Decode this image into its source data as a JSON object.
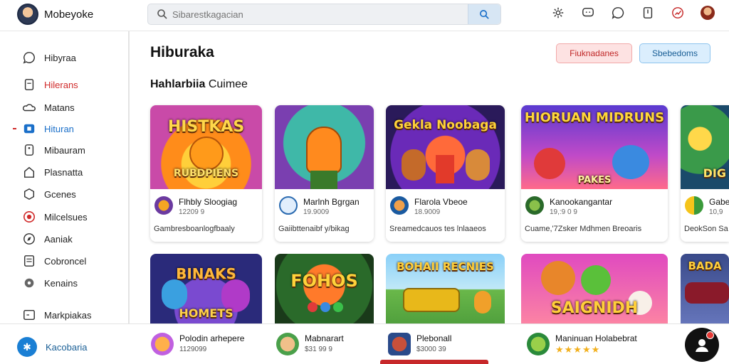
{
  "header": {
    "brand": "Mobeyoke",
    "search_placeholder": "Sibarestkagacian",
    "icons": [
      "gear-icon",
      "chat-icon",
      "message-icon",
      "share-icon",
      "notification-icon",
      "user-avatar"
    ]
  },
  "sidebar": {
    "items": [
      {
        "label": "Hibyraa",
        "icon": "speech-icon",
        "state": "normal"
      },
      {
        "label": "Hilerans",
        "icon": "bookmark-icon",
        "state": "red"
      },
      {
        "label": "Matans",
        "icon": "cloud-icon",
        "state": "normal"
      },
      {
        "label": "Hituran",
        "icon": "play-box-icon",
        "state": "active"
      },
      {
        "label": "Mibauram",
        "icon": "tag-icon",
        "state": "normal"
      },
      {
        "label": "Plasnatta",
        "icon": "house-icon",
        "state": "normal"
      },
      {
        "label": "Gcenes",
        "icon": "cube-icon",
        "state": "normal"
      },
      {
        "label": "Milcelsues",
        "icon": "target-icon",
        "state": "red-icon"
      },
      {
        "label": "Aaniak",
        "icon": "compass-icon",
        "state": "normal"
      },
      {
        "label": "Cobroncel",
        "icon": "document-icon",
        "state": "normal"
      },
      {
        "label": "Kenains",
        "icon": "circle-icon",
        "state": "normal"
      },
      {
        "label": "Markpiakas",
        "icon": "monitor-icon",
        "state": "normal"
      }
    ]
  },
  "main": {
    "title": "Hiburaka",
    "btn_red": "Fiuknadanes",
    "btn_blue": "Sbebedoms",
    "section_bold": "Hahlarbiia",
    "section_rest": "Cuimee"
  },
  "cards": [
    {
      "art_text": "HISTKAS",
      "art_sub": "RUBDPIENS",
      "title": "Flhbly Sloogiag",
      "meta": "12209 9",
      "desc": "Gambresboanlogfbaaly"
    },
    {
      "art_text": "",
      "art_sub": "",
      "title": "Marlnh Bgrgan",
      "meta": "19.9009",
      "desc": "Gaiibttenaibf y/bikag"
    },
    {
      "art_text": "Gekla Noobaga",
      "art_sub": "",
      "title": "Flarola Vbeoe",
      "meta": "18.9009",
      "desc": "Sreamedcauos tes lnlaaeos"
    },
    {
      "art_text": "HIORUAN MIDRUNS",
      "art_sub": "PAKES",
      "title": "Kanookangantar",
      "meta": "19,:9 0 9",
      "desc": "Cuame,'7Zsker Mdhmen Breoaris"
    },
    {
      "art_text": "DIG",
      "art_sub": "",
      "title": "Gabe",
      "meta": "10,9",
      "desc": "DeokSon Sa"
    }
  ],
  "cards_row2": [
    {
      "art_text": "BINAKS",
      "art_sub": "HOMETS"
    },
    {
      "art_text": "FOHOS",
      "art_sub": ""
    },
    {
      "art_text": "BOHAII RECNIES",
      "art_sub": ""
    },
    {
      "art_text": "SAIGNIDH",
      "art_sub": ""
    },
    {
      "art_text": "BADA",
      "art_sub": ""
    }
  ],
  "bottom": {
    "main_label": "Kacobaria",
    "items": [
      {
        "title": "Polodin arhepere",
        "meta": "1129099"
      },
      {
        "title": "Mabnarart",
        "meta": "$31 99 9"
      },
      {
        "title": "Plebonall",
        "meta": "$3000 39"
      },
      {
        "title": "Maninuan Holabebrat",
        "rating": "★★★★★"
      }
    ]
  }
}
